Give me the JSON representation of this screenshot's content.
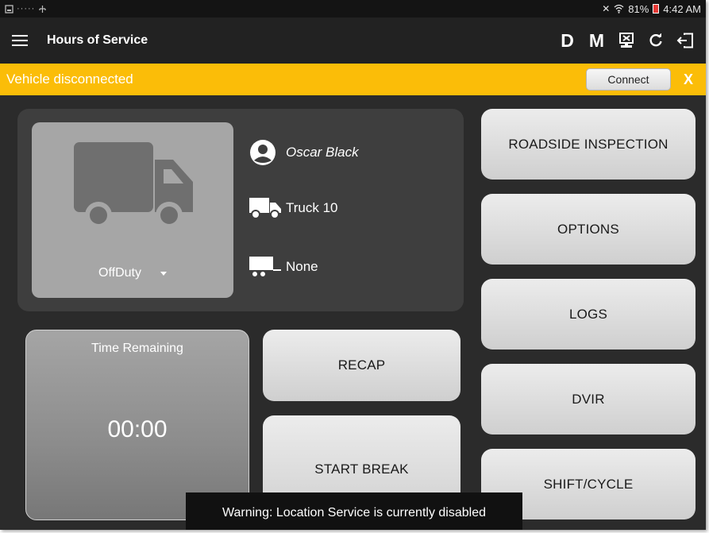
{
  "status_bar": {
    "battery": "81%",
    "time": "4:42 AM"
  },
  "toolbar": {
    "title": "Hours of Service",
    "action_d": "D",
    "action_m": "M"
  },
  "alert": {
    "text": "Vehicle disconnected",
    "connect_label": "Connect",
    "close_label": "X",
    "color": "#fbbd08"
  },
  "driver": {
    "name": "Oscar Black",
    "truck": "Truck 10",
    "trailer": "None",
    "duty_status": "OffDuty"
  },
  "time_remaining": {
    "label": "Time Remaining",
    "value": "00:00"
  },
  "buttons": {
    "recap": "RECAP",
    "start_break": "START BREAK",
    "roadside": "ROADSIDE INSPECTION",
    "options": "OPTIONS",
    "logs": "LOGS",
    "dvir": "DVIR",
    "shift_cycle": "SHIFT/CYCLE"
  },
  "toast": {
    "text": "Warning: Location Service is currently disabled"
  }
}
